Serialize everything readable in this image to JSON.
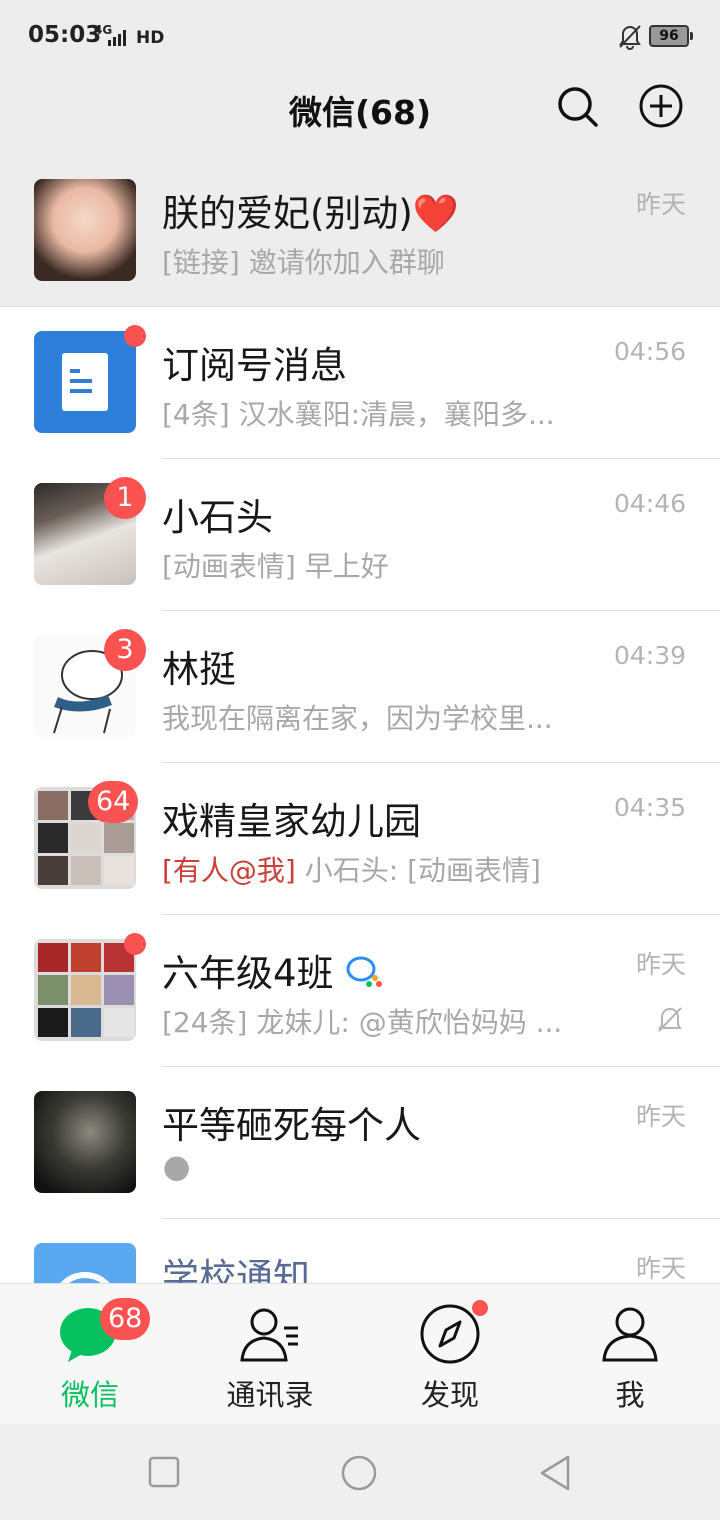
{
  "status_bar": {
    "time": "05:03",
    "network": "4G",
    "hd": "HD",
    "battery": "96"
  },
  "header": {
    "title": "微信(68)",
    "search_icon": "search-icon",
    "add_icon": "plus-circle-icon"
  },
  "chats": [
    {
      "name": "朕的爱妃(别动)",
      "name_emoji": "❤️",
      "preview": "[链接] 邀请你加入群聊",
      "time": "昨天",
      "pinned": true
    },
    {
      "name": "订阅号消息",
      "preview": "[4条] 汉水襄阳:清晨，襄阳多...",
      "time": "04:56",
      "dot": true
    },
    {
      "name": "小石头",
      "preview": "[动画表情] 早上好",
      "time": "04:46",
      "badge": "1"
    },
    {
      "name": "林挺",
      "preview": "我现在隔离在家，因为学校里...",
      "time": "04:39",
      "badge": "3"
    },
    {
      "name": "戏精皇家幼儿园",
      "mention": "[有人@我]",
      "preview": " 小石头: [动画表情]",
      "time": "04:35",
      "badge": "64"
    },
    {
      "name": "六年级4班",
      "preview": "[24条] 龙妹儿: @黄欣怡妈妈 ...",
      "time": "昨天",
      "dot": true,
      "muted": true
    },
    {
      "name": "平等砸死每个人",
      "preview": "🌑",
      "time": "昨天"
    },
    {
      "name": "学校通知",
      "preview": "",
      "time": "昨天"
    }
  ],
  "tab_bar": {
    "tabs": [
      {
        "label": "微信",
        "icon": "chat-bubble-icon",
        "badge": "68",
        "active": true
      },
      {
        "label": "通讯录",
        "icon": "contacts-icon"
      },
      {
        "label": "发现",
        "icon": "compass-icon",
        "dot": true
      },
      {
        "label": "我",
        "icon": "person-icon"
      }
    ]
  },
  "colors": {
    "accent": "#07c160",
    "badge": "#fa5151",
    "background": "#ededed"
  }
}
